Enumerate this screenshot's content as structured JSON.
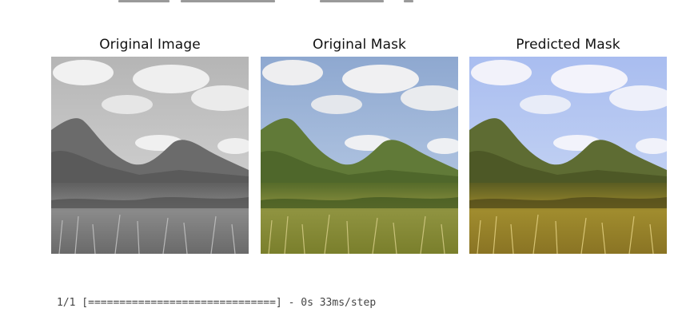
{
  "panels": [
    {
      "title": "Original Image",
      "image": "grayscale-landscape"
    },
    {
      "title": "Original Mask",
      "image": "color-landscape"
    },
    {
      "title": "Predicted Mask",
      "image": "predicted-color-landscape"
    }
  ],
  "output": {
    "progress_line": "1/1 [==============================] - 0s 33ms/step"
  },
  "colors": {
    "gray_sky": "#c9c9c9",
    "gray_mountain": "#6e6e6e",
    "gray_field": "#7a7a7a",
    "color_sky": "#9fb6d8",
    "color_mountain": "#5f7a3c",
    "color_field": "#8a8f3a",
    "pred_sky": "#b8c8ea",
    "pred_mountain": "#5e6e34",
    "pred_field": "#9c8a2e"
  }
}
